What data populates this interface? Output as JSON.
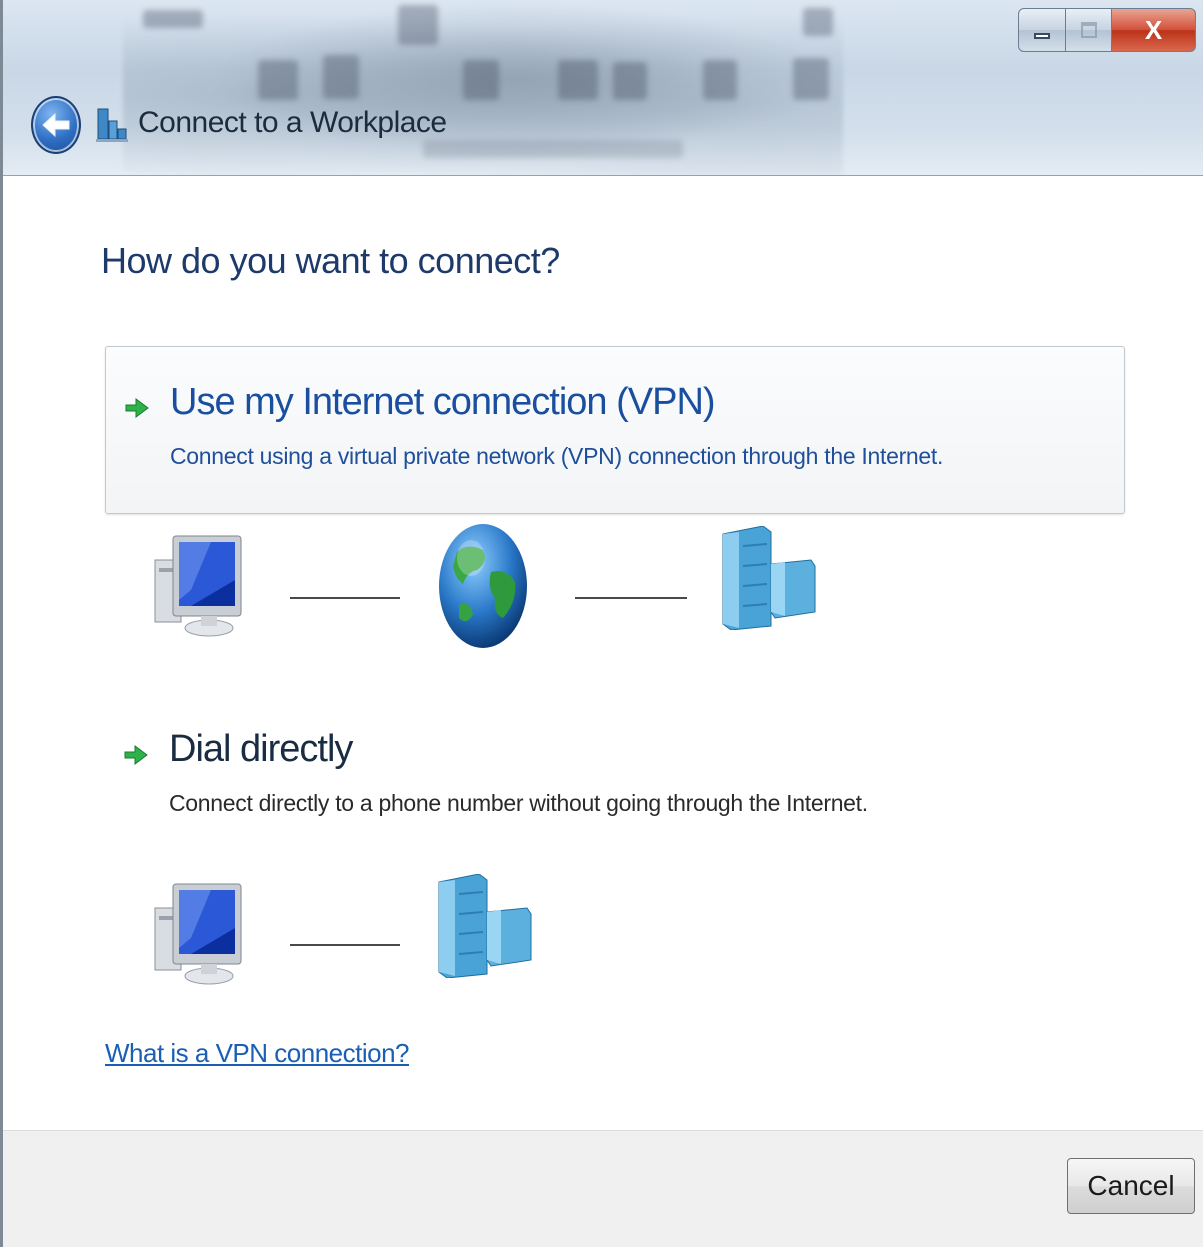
{
  "window": {
    "title": "Connect to a Workplace",
    "close_glyph": "X"
  },
  "heading": "How do you want to connect?",
  "options": [
    {
      "title": "Use my Internet connection (VPN)",
      "description": "Connect using a virtual private network (VPN) connection through the Internet.",
      "icon": "green-arrow-icon",
      "highlighted": true,
      "diagram": [
        "computer-icon",
        "globe-icon",
        "server-icon"
      ]
    },
    {
      "title": "Dial directly",
      "description": "Connect directly to a phone number without going through the Internet.",
      "icon": "green-arrow-icon",
      "highlighted": false,
      "diagram": [
        "computer-icon",
        "server-icon"
      ]
    }
  ],
  "help_link": "What is a VPN connection?",
  "footer": {
    "cancel_label": "Cancel"
  },
  "colors": {
    "accent_link": "#1a5fb4",
    "heading": "#1e3a6a",
    "arrow": "#2db24a",
    "close_button": "#c9432b"
  }
}
